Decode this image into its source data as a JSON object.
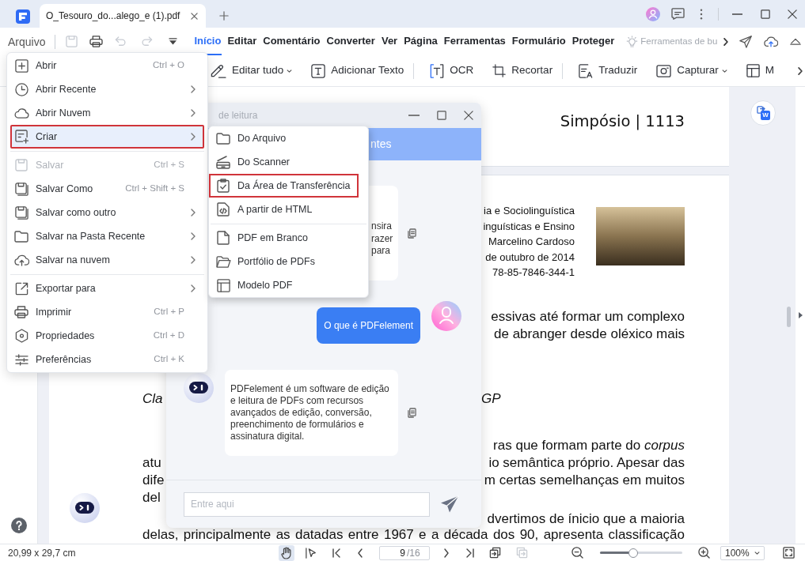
{
  "title_bar": {
    "tab_title": "O_Tesouro_do...alego_e (1).pdf"
  },
  "quick_access": {
    "file_menu_label": "Arquivo",
    "tools": [
      {
        "disabled": true
      },
      {
        "disabled": false
      },
      {
        "disabled": true
      },
      {
        "disabled": true
      },
      {
        "disabled": false
      }
    ]
  },
  "menu_tabs": [
    {
      "label": "Início",
      "selected": true
    },
    {
      "label": "Editar",
      "selected": false
    },
    {
      "label": "Comentário",
      "selected": false
    },
    {
      "label": "Converter",
      "selected": false
    },
    {
      "label": "Ver",
      "selected": false
    },
    {
      "label": "Página",
      "selected": false
    },
    {
      "label": "Ferramentas",
      "selected": false
    },
    {
      "label": "Formulário",
      "selected": false
    },
    {
      "label": "Proteger",
      "selected": false
    }
  ],
  "tool_search": {
    "placeholder": "Ferramentas de bu"
  },
  "ribbon": {
    "groups": [
      [
        {
          "label": "Editar tudo",
          "dropdown": true
        },
        {
          "label": "Adicionar Texto",
          "dropdown": false
        }
      ],
      [
        {
          "label": "OCR",
          "dropdown": false
        },
        {
          "label": "Recortar",
          "dropdown": false
        }
      ],
      [
        {
          "label": "Traduzir",
          "dropdown": false
        },
        {
          "label": "Capturar",
          "dropdown": true
        },
        {
          "label": "M",
          "dropdown": false
        }
      ]
    ]
  },
  "file_menu": {
    "groups": [
      [
        {
          "label": "Abrir",
          "shortcut": "Ctrl + O",
          "submenu": false,
          "selected": false,
          "outlined": false,
          "disabled": false
        },
        {
          "label": "Abrir Recente",
          "submenu": true,
          "selected": false,
          "outlined": false,
          "disabled": false
        },
        {
          "label": "Abrir Nuvem",
          "submenu": true,
          "selected": false,
          "outlined": false,
          "disabled": false
        },
        {
          "label": "Criar",
          "submenu": true,
          "selected": true,
          "outlined": true,
          "disabled": false
        }
      ],
      [
        {
          "label": "Salvar",
          "shortcut": "Ctrl + S",
          "submenu": false,
          "selected": false,
          "outlined": false,
          "disabled": true
        },
        {
          "label": "Salvar Como",
          "shortcut": "Ctrl + Shift + S",
          "submenu": false,
          "selected": false,
          "outlined": false,
          "disabled": false
        },
        {
          "label": "Salvar como outro",
          "submenu": true,
          "selected": false,
          "outlined": false,
          "disabled": false
        },
        {
          "label": "Salvar na Pasta Recente",
          "submenu": true,
          "selected": false,
          "outlined": false,
          "disabled": false
        },
        {
          "label": "Salvar na nuvem",
          "submenu": true,
          "selected": false,
          "outlined": false,
          "disabled": false
        }
      ],
      [
        {
          "label": "Exportar para",
          "submenu": true,
          "selected": false,
          "outlined": false,
          "disabled": false
        },
        {
          "label": "Imprimir",
          "shortcut": "Ctrl + P",
          "submenu": false,
          "selected": false,
          "outlined": false,
          "disabled": false
        },
        {
          "label": "Propriedades",
          "shortcut": "Ctrl + D",
          "submenu": false,
          "selected": false,
          "outlined": false,
          "disabled": false
        },
        {
          "label": "Preferências",
          "shortcut": "Ctrl + K",
          "submenu": false,
          "selected": false,
          "outlined": false,
          "disabled": false
        }
      ]
    ]
  },
  "create_submenu": {
    "groups": [
      [
        {
          "label": "Do Arquivo",
          "outlined": false
        },
        {
          "label": "Do Scanner",
          "outlined": false
        },
        {
          "label": "Da Área de Transferência",
          "outlined": true
        },
        {
          "label": "A partir de HTML",
          "outlined": false
        }
      ],
      [
        {
          "label": "PDF em Branco",
          "outlined": false
        },
        {
          "label": "Portfólio de PDFs",
          "outlined": false
        },
        {
          "label": "Modelo PDF",
          "outlined": false
        }
      ]
    ]
  },
  "document": {
    "page_header": "Simpósio | 1113",
    "info_lines": [
      "ia e Sociolinguística",
      "inguísticas e Ensino",
      "Marcelino Cardoso",
      "de outubro de 2014",
      "78-85-7846-344-1"
    ],
    "blocks": [
      {
        "kind": "paragraph",
        "lines": [
          {
            "right": "essivas até formar um complexo"
          },
          {
            "right": "de abranger desde oléxico mais"
          }
        ]
      },
      {
        "kind": "heading",
        "lines": [
          {
            "left": "Cla",
            "right": "GP"
          }
        ]
      },
      {
        "kind": "paragraph",
        "lines": [
          {
            "right": "ras que formam parte do *corpus*"
          },
          {
            "left": "atu",
            "right": "io semântica próprio. Apesar das"
          },
          {
            "left": "dife",
            "right": "m certas semelhanças em muitos"
          },
          {
            "left": "del"
          }
        ]
      },
      {
        "kind": "paragraph",
        "lines": [
          {
            "right": "dvertimos de ínicio que a maioria"
          },
          {
            "full": "delas, principalmente as datadas entre 1967 e a década dos 90, apresenta classificação"
          }
        ]
      }
    ]
  },
  "chat": {
    "title": "de leitura",
    "header": "ntes",
    "messages": [
      {
        "kind": "bot",
        "avatar": false,
        "lines": [
          "nsira",
          "razer",
          "para"
        ]
      },
      {
        "kind": "user",
        "avatar": true,
        "text": "O que é PDFelement"
      },
      {
        "kind": "bot",
        "avatar": true,
        "text": "PDFelement é um software de edição e leitura de PDFs com recursos avançados de edição, conversão, preenchimento de formulários e assinatura digital."
      }
    ],
    "input": {
      "placeholder": "Entre aqui"
    }
  },
  "convert_button": {
    "format": "W"
  },
  "status_bar": {
    "page_size": "20,99 x 29,7 cm",
    "tools": [
      {
        "selected": true
      },
      {
        "selected": false
      }
    ],
    "page": "9",
    "page_count": "/16",
    "view_tools": [
      {
        "disabled": false
      },
      {
        "disabled": true
      }
    ],
    "zoom": {
      "level": 0.4
    },
    "zoom_value": "100%"
  }
}
